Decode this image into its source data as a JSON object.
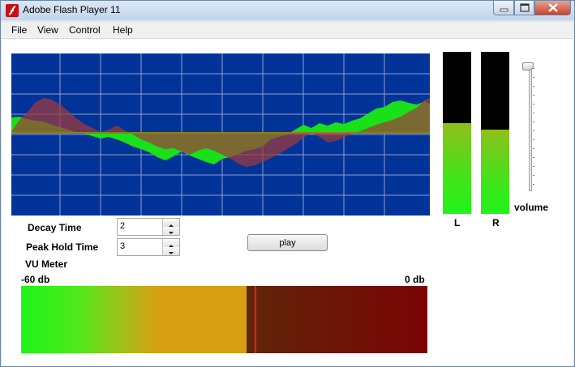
{
  "window": {
    "title": "Adobe Flash Player 11"
  },
  "menu": [
    "File",
    "View",
    "Control",
    "Help"
  ],
  "controls": {
    "decay_label": "Decay Time",
    "decay_value": "2",
    "peak_label": "Peak Hold Time",
    "peak_value": "3",
    "play_label": "play"
  },
  "vu_meter": {
    "title": "VU Meter",
    "min_label": "-60 db",
    "max_label": "0 db",
    "level_fraction": 0.555,
    "peak_fraction": 0.575
  },
  "channels": {
    "left_label": "L",
    "right_label": "R",
    "left_level": 0.56,
    "right_level": 0.52
  },
  "volume": {
    "label": "volume",
    "level": 1.0
  },
  "colors": {
    "scope_bg": "#023399",
    "green": "#19e019",
    "red": "#a03a3a",
    "olive": "#8a7f1e",
    "peak": "#ff1a1a"
  }
}
